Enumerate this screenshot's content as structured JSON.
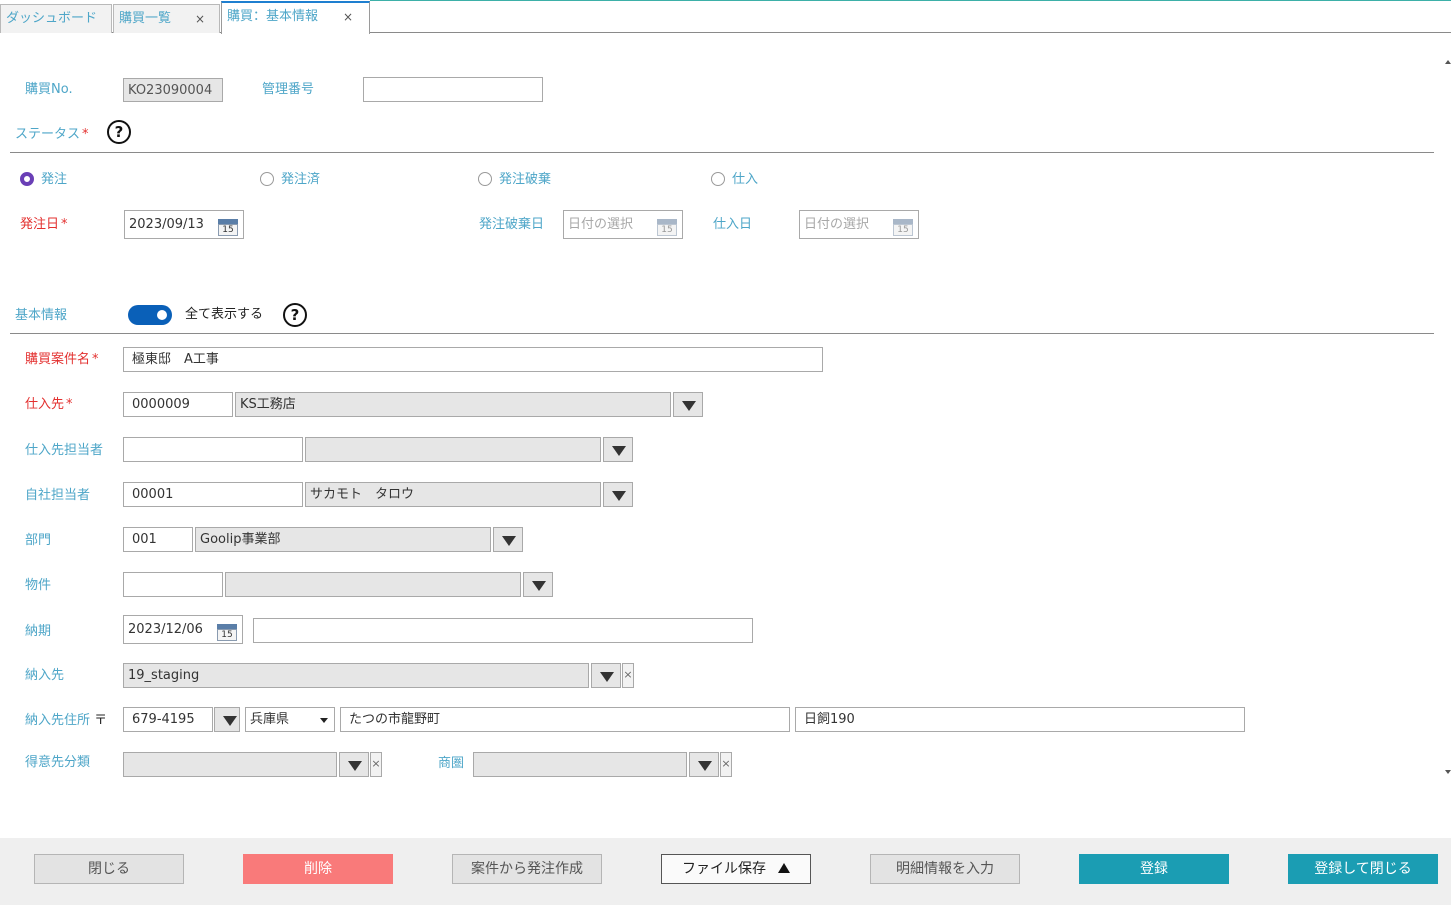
{
  "tabs": [
    {
      "label": "ダッシュボード",
      "closable": false
    },
    {
      "label": "購買一覧",
      "closable": true
    },
    {
      "label": "購買：基本情報",
      "closable": true
    }
  ],
  "close_glyph": "×",
  "header": {
    "purchase_no_label": "購買No.",
    "purchase_no_value": "KO23090004",
    "mgmt_no_label": "管理番号",
    "mgmt_no_value": ""
  },
  "status": {
    "label": "ステータス",
    "required_mark": "*",
    "help": "?",
    "options": [
      {
        "label": "発注",
        "selected": true
      },
      {
        "label": "発注済",
        "selected": false
      },
      {
        "label": "発注破棄",
        "selected": false
      },
      {
        "label": "仕入",
        "selected": false
      }
    ],
    "order_date_label": "発注日",
    "order_date_value": "2023/09/13",
    "cancel_date_label": "発注破棄日",
    "cancel_date_placeholder": "日付の選択",
    "purchase_date_label": "仕入日",
    "purchase_date_placeholder": "日付の選択",
    "calendar_day": "15"
  },
  "basic": {
    "label": "基本情報",
    "show_all_label": "全て表示する",
    "show_all_on": true,
    "help": "?",
    "required_mark": "*",
    "project_name_label": "購買案件名",
    "project_name_value": "極東邸　A工事",
    "supplier_label": "仕入先",
    "supplier_code": "0000009",
    "supplier_name": "KS工務店",
    "supplier_person_label": "仕入先担当者",
    "supplier_person_code": "",
    "supplier_person_name": "",
    "staff_label": "自社担当者",
    "staff_code": "00001",
    "staff_name": "サカモト　タロウ",
    "dept_label": "部門",
    "dept_code": "001",
    "dept_name": "Goolip事業部",
    "property_label": "物件",
    "property_code": "",
    "property_name": "",
    "delivery_date_label": "納期",
    "delivery_date_value": "2023/12/06",
    "delivery_note": "",
    "delivery_to_label": "納入先",
    "delivery_to_value": "19_staging",
    "address_label": "納入先住所",
    "zip_mark": "〒",
    "zip_value": "679-4195",
    "prefecture": "兵庫県",
    "city": "たつの市龍野町",
    "street": "日飼190",
    "customer_class_label": "得意先分類",
    "customer_class_value": "",
    "trade_area_label": "商圏",
    "trade_area_value": ""
  },
  "footer": {
    "close": "閉じる",
    "delete": "削除",
    "create_from_project": "案件から発注作成",
    "file_save": "ファイル保存",
    "enter_details": "明細情報を入力",
    "register": "登録",
    "register_close": "登録して閉じる"
  },
  "colors": {
    "label": "#4ea6c8",
    "required": "#e3302f",
    "radio_selected": "#6a3fb6",
    "toggle": "#0a60b8",
    "delete_button": "#f97a7a",
    "primary_button": "#1b9db3"
  }
}
